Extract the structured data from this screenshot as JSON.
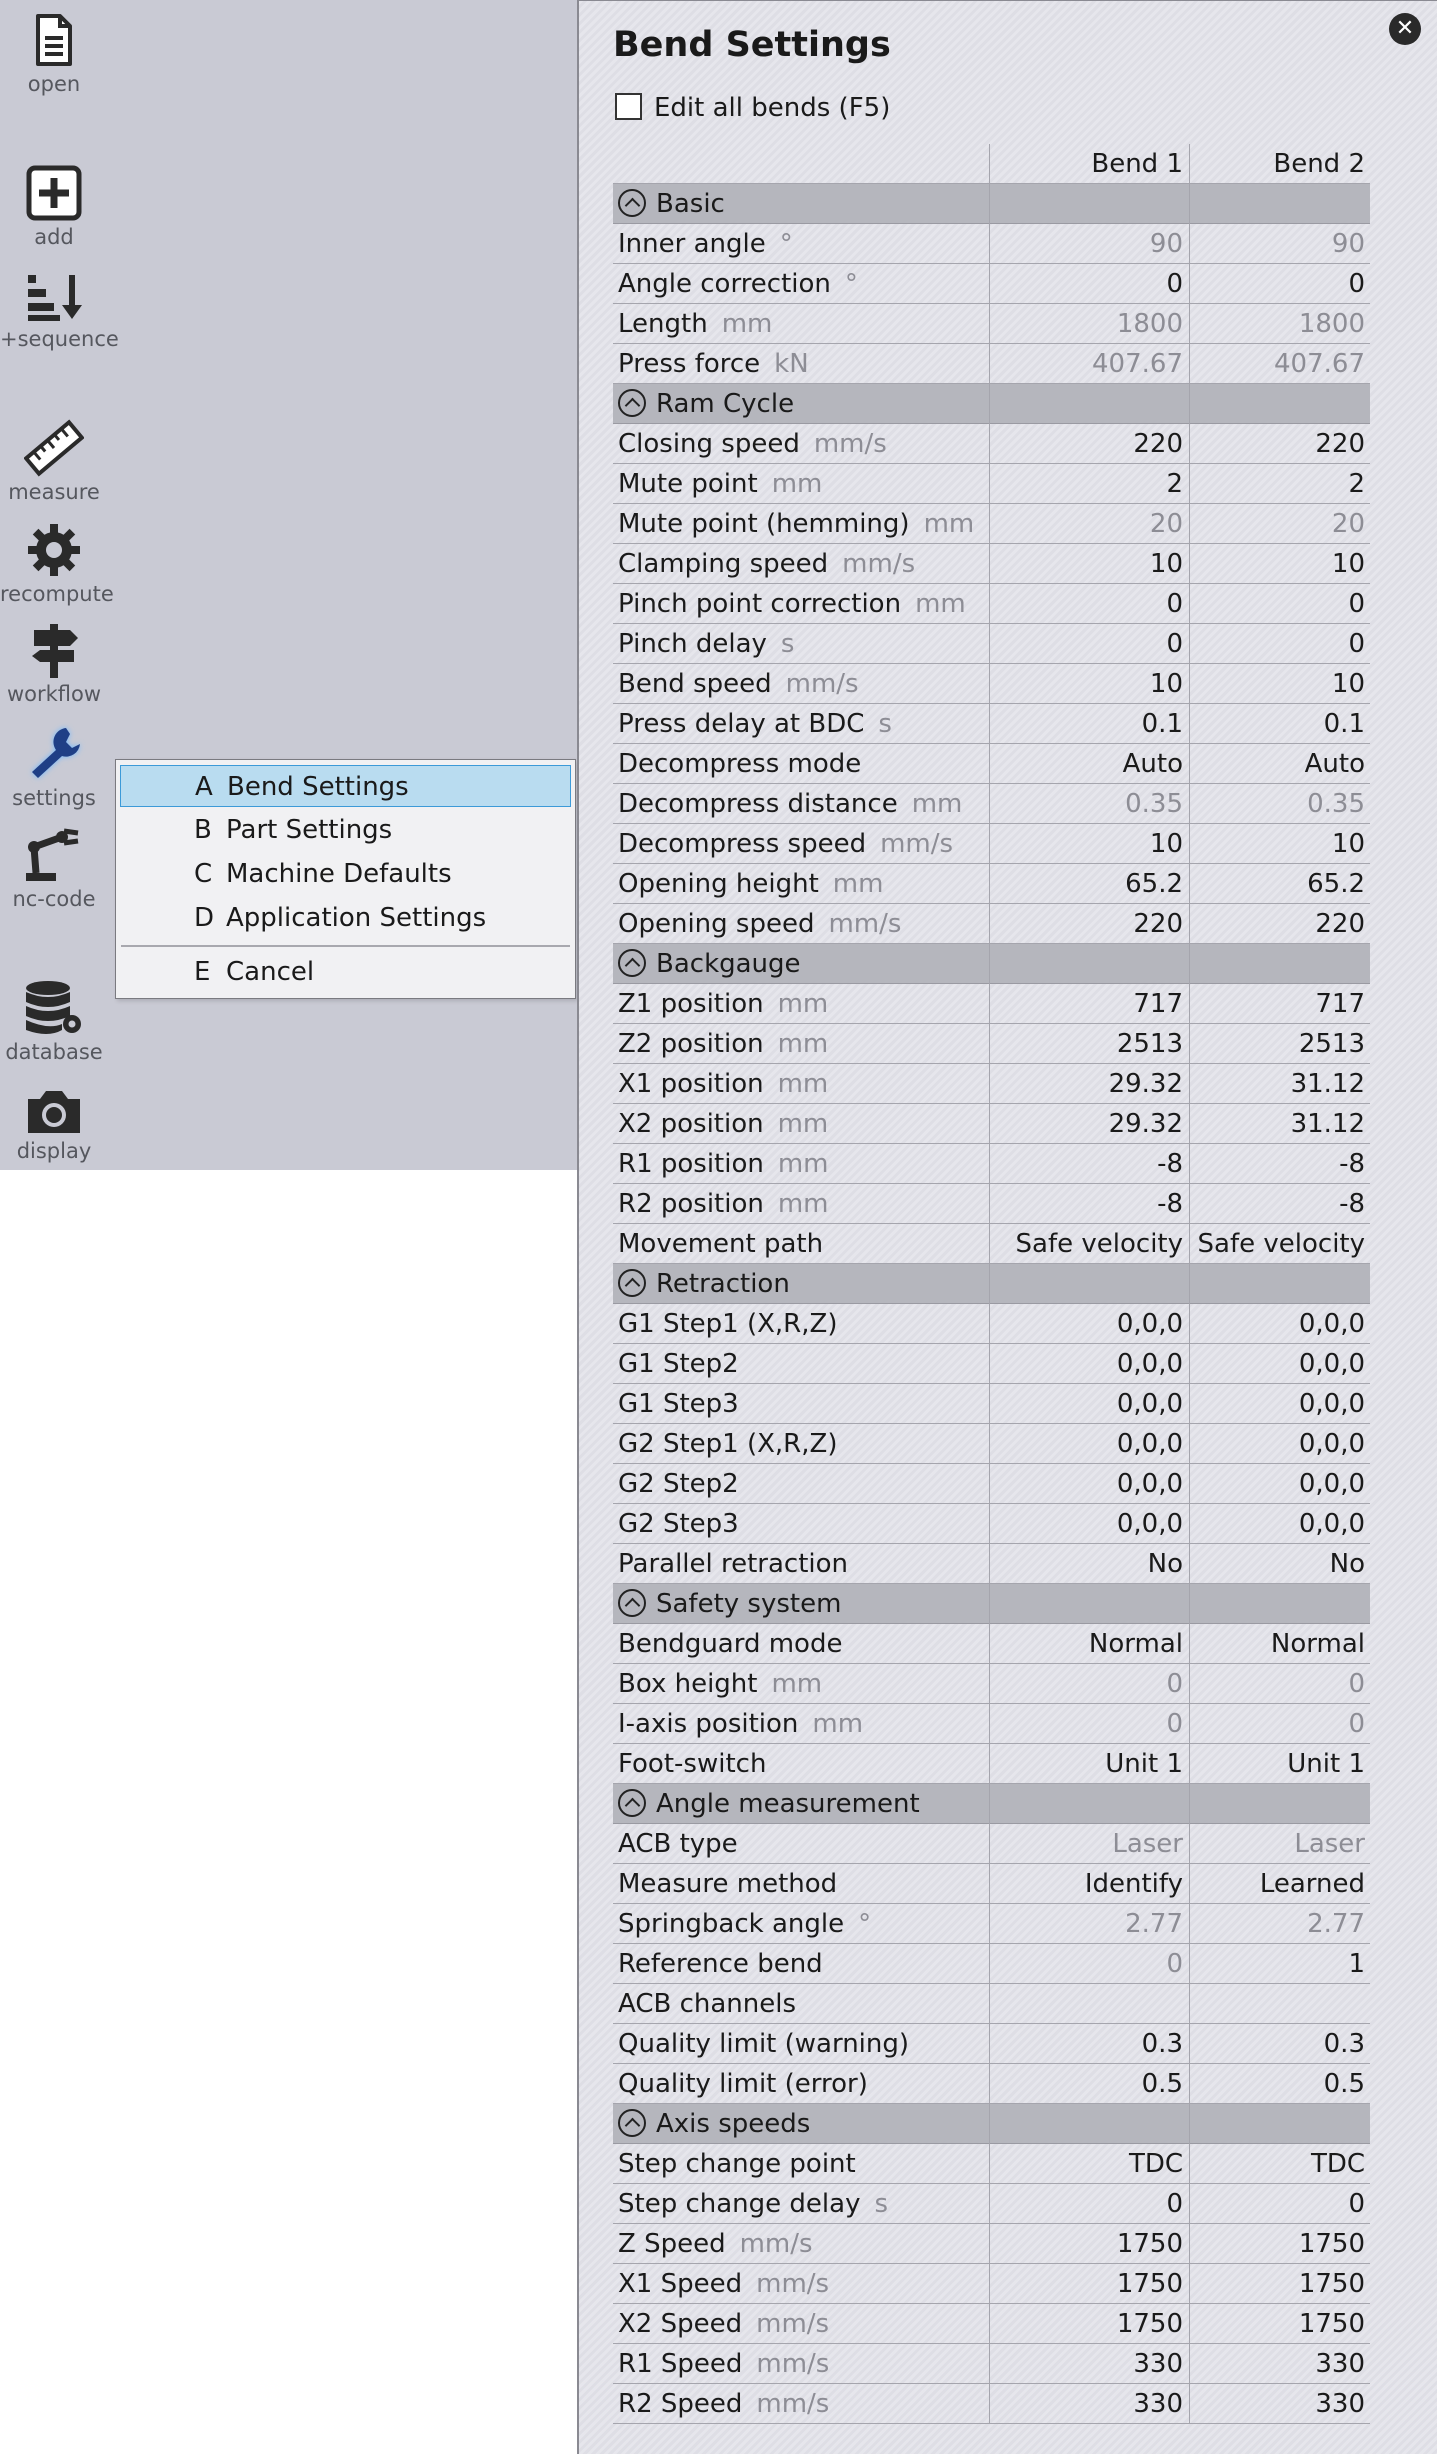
{
  "toolbar": {
    "items": [
      {
        "id": "open",
        "label": "open",
        "icon": "document-icon"
      },
      {
        "id": "add",
        "label": "add",
        "icon": "plus-box-icon"
      },
      {
        "id": "sequence",
        "label": "+sequence",
        "icon": "sort-down-icon"
      },
      {
        "id": "measure",
        "label": "measure",
        "icon": "ruler-icon"
      },
      {
        "id": "recompute",
        "label": "recompute",
        "icon": "gear-icon"
      },
      {
        "id": "workflow",
        "label": "workflow",
        "icon": "signpost-icon"
      },
      {
        "id": "settings",
        "label": "settings",
        "icon": "wrench-icon"
      },
      {
        "id": "nc-code",
        "label": "nc-code",
        "icon": "robot-arm-icon"
      },
      {
        "id": "database",
        "label": "database",
        "icon": "database-gear-icon"
      },
      {
        "id": "display",
        "label": "display",
        "icon": "camera-icon"
      }
    ]
  },
  "menu": {
    "items": [
      {
        "key": "A",
        "label": "Bend Settings",
        "selected": true
      },
      {
        "key": "B",
        "label": "Part Settings"
      },
      {
        "key": "C",
        "label": "Machine Defaults"
      },
      {
        "key": "D",
        "label": "Application Settings"
      },
      {
        "key": "E",
        "label": "Cancel"
      }
    ]
  },
  "panel": {
    "title": "Bend Settings",
    "close": "✕",
    "edit_all": "Edit all bends (F5)",
    "columns": [
      "Bend 1",
      "Bend 2"
    ]
  },
  "rows": [
    {
      "type": "sec",
      "label": "Basic"
    },
    {
      "label": "Inner angle",
      "unit": "°",
      "v1": "90",
      "v2": "90",
      "dis": true
    },
    {
      "label": "Angle correction",
      "unit": "°",
      "v1": "0",
      "v2": "0"
    },
    {
      "label": "Length",
      "unit": "mm",
      "v1": "1800",
      "v2": "1800",
      "dis": true
    },
    {
      "label": "Press force",
      "unit": "kN",
      "v1": "407.67",
      "v2": "407.67",
      "dis": true
    },
    {
      "type": "sec",
      "label": "Ram Cycle"
    },
    {
      "label": "Closing speed",
      "unit": "mm/s",
      "v1": "220",
      "v2": "220"
    },
    {
      "label": "Mute point",
      "unit": "mm",
      "v1": "2",
      "v2": "2"
    },
    {
      "label": "Mute point (hemming)",
      "unit": "mm",
      "v1": "20",
      "v2": "20",
      "dis": true
    },
    {
      "label": "Clamping speed",
      "unit": "mm/s",
      "v1": "10",
      "v2": "10"
    },
    {
      "label": "Pinch point correction",
      "unit": "mm",
      "v1": "0",
      "v2": "0"
    },
    {
      "label": "Pinch delay",
      "unit": "s",
      "v1": "0",
      "v2": "0"
    },
    {
      "label": "Bend speed",
      "unit": "mm/s",
      "v1": "10",
      "v2": "10"
    },
    {
      "label": "Press delay at BDC",
      "unit": "s",
      "v1": "0.1",
      "v2": "0.1"
    },
    {
      "label": "Decompress mode",
      "unit": "",
      "v1": "Auto",
      "v2": "Auto"
    },
    {
      "label": "Decompress distance",
      "unit": "mm",
      "v1": "0.35",
      "v2": "0.35",
      "dis": true
    },
    {
      "label": "Decompress speed",
      "unit": "mm/s",
      "v1": "10",
      "v2": "10"
    },
    {
      "label": "Opening height",
      "unit": "mm",
      "v1": "65.2",
      "v2": "65.2"
    },
    {
      "label": "Opening speed",
      "unit": "mm/s",
      "v1": "220",
      "v2": "220"
    },
    {
      "type": "sec",
      "label": "Backgauge"
    },
    {
      "label": "Z1 position",
      "unit": "mm",
      "v1": "717",
      "v2": "717"
    },
    {
      "label": "Z2 position",
      "unit": "mm",
      "v1": "2513",
      "v2": "2513"
    },
    {
      "label": "X1 position",
      "unit": "mm",
      "v1": "29.32",
      "v2": "31.12"
    },
    {
      "label": "X2 position",
      "unit": "mm",
      "v1": "29.32",
      "v2": "31.12"
    },
    {
      "label": "R1 position",
      "unit": "mm",
      "v1": "-8",
      "v2": "-8"
    },
    {
      "label": "R2 position",
      "unit": "mm",
      "v1": "-8",
      "v2": "-8"
    },
    {
      "label": "Movement path",
      "unit": "",
      "v1": "Safe velocity",
      "v2": "Safe velocity"
    },
    {
      "type": "sec",
      "label": "Retraction"
    },
    {
      "label": "G1 Step1 (X,R,Z)",
      "unit": "",
      "v1": "0,0,0",
      "v2": "0,0,0"
    },
    {
      "label": "G1 Step2",
      "unit": "",
      "v1": "0,0,0",
      "v2": "0,0,0"
    },
    {
      "label": "G1 Step3",
      "unit": "",
      "v1": "0,0,0",
      "v2": "0,0,0"
    },
    {
      "label": "G2 Step1 (X,R,Z)",
      "unit": "",
      "v1": "0,0,0",
      "v2": "0,0,0"
    },
    {
      "label": "G2 Step2",
      "unit": "",
      "v1": "0,0,0",
      "v2": "0,0,0"
    },
    {
      "label": "G2 Step3",
      "unit": "",
      "v1": "0,0,0",
      "v2": "0,0,0"
    },
    {
      "label": "Parallel retraction",
      "unit": "",
      "v1": "No",
      "v2": "No"
    },
    {
      "type": "sec",
      "label": "Safety system"
    },
    {
      "label": "Bendguard mode",
      "unit": "",
      "v1": "Normal",
      "v2": "Normal"
    },
    {
      "label": "Box height",
      "unit": "mm",
      "v1": "0",
      "v2": "0",
      "dis": true
    },
    {
      "label": "I-axis position",
      "unit": "mm",
      "v1": "0",
      "v2": "0",
      "dis": true
    },
    {
      "label": "Foot-switch",
      "unit": "",
      "v1": "Unit 1",
      "v2": "Unit 1"
    },
    {
      "type": "sec",
      "label": "Angle measurement"
    },
    {
      "label": "ACB type",
      "unit": "",
      "v1": "Laser",
      "v2": "Laser",
      "dis": true
    },
    {
      "label": "Measure method",
      "unit": "",
      "v1": "Identify",
      "v2": "Learned"
    },
    {
      "label": "Springback angle",
      "unit": "°",
      "v1": "2.77",
      "v2": "2.77",
      "dis": true
    },
    {
      "label": "Reference bend",
      "unit": "",
      "v1": "0",
      "v2": "1",
      "dis1": true
    },
    {
      "label": "ACB channels",
      "unit": "",
      "v1": "",
      "v2": ""
    },
    {
      "label": "Quality limit (warning)",
      "unit": "",
      "v1": "0.3",
      "v2": "0.3"
    },
    {
      "label": "Quality limit (error)",
      "unit": "",
      "v1": "0.5",
      "v2": "0.5"
    },
    {
      "type": "sec",
      "label": "Axis speeds"
    },
    {
      "label": "Step change point",
      "unit": "",
      "v1": "TDC",
      "v2": "TDC"
    },
    {
      "label": "Step change delay",
      "unit": "s",
      "v1": "0",
      "v2": "0"
    },
    {
      "label": "Z Speed",
      "unit": "mm/s",
      "v1": "1750",
      "v2": "1750"
    },
    {
      "label": "X1 Speed",
      "unit": "mm/s",
      "v1": "1750",
      "v2": "1750"
    },
    {
      "label": "X2 Speed",
      "unit": "mm/s",
      "v1": "1750",
      "v2": "1750"
    },
    {
      "label": "R1 Speed",
      "unit": "mm/s",
      "v1": "330",
      "v2": "330"
    },
    {
      "label": "R2 Speed",
      "unit": "mm/s",
      "v1": "330",
      "v2": "330"
    }
  ]
}
